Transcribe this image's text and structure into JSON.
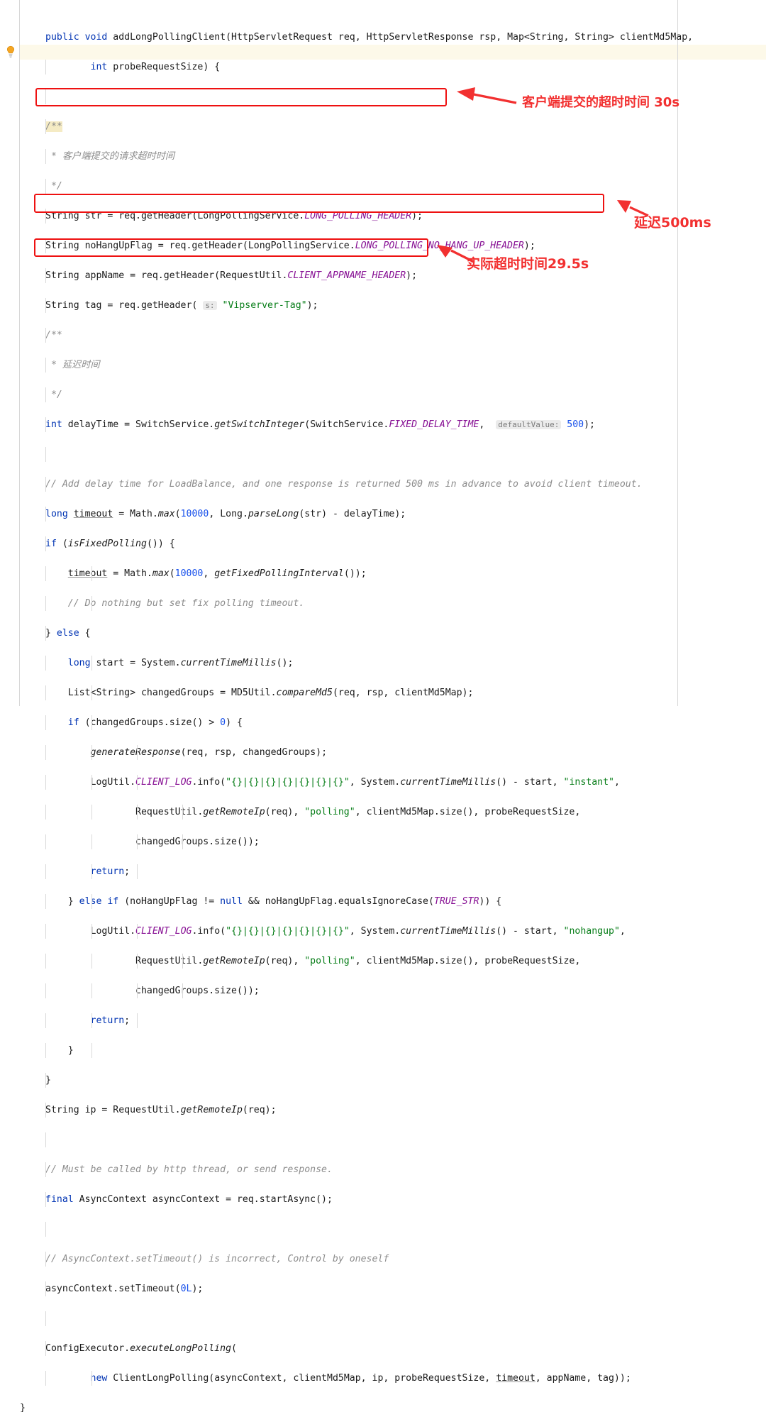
{
  "app": {
    "kind": "code-editor",
    "language": "java"
  },
  "gutter": {
    "icon": "lightbulb-icon"
  },
  "colors": {
    "background": "#ffffff",
    "keyword": "#0033b3",
    "number": "#1750eb",
    "string": "#067d17",
    "comment": "#8c8c8c",
    "static_field": "#871094",
    "annotation_red": "#f23030",
    "box_red": "#ee1111",
    "caret_line": "#fdf9e9",
    "guide": "#d8d8d8"
  },
  "code": {
    "lines": [
      "public void addLongPollingClient(HttpServletRequest req, HttpServletResponse rsp, Map<String, String> clientMd5Map,",
      "        int probeRequestSize) {",
      "",
      "    /**",
      "     * 客户端提交的请求超时时间",
      "     */",
      "    String str = req.getHeader(LongPollingService.LONG_POLLING_HEADER);",
      "    String noHangUpFlag = req.getHeader(LongPollingService.LONG_POLLING_NO_HANG_UP_HEADER);",
      "    String appName = req.getHeader(RequestUtil.CLIENT_APPNAME_HEADER);",
      "    String tag = req.getHeader( s: \"Vipserver-Tag\");",
      "    /**",
      "     * 延迟时间",
      "     */",
      "    int delayTime = SwitchService.getSwitchInteger(SwitchService.FIXED_DELAY_TIME,  defaultValue: 500);",
      "",
      "    // Add delay time for LoadBalance, and one response is returned 500 ms in advance to avoid client timeout.",
      "    long timeout = Math.max(10000, Long.parseLong(str) - delayTime);",
      "    if (isFixedPolling()) {",
      "        timeout = Math.max(10000, getFixedPollingInterval());",
      "        // Do nothing but set fix polling timeout.",
      "    } else {",
      "        long start = System.currentTimeMillis();",
      "        List<String> changedGroups = MD5Util.compareMd5(req, rsp, clientMd5Map);",
      "        if (changedGroups.size() > 0) {",
      "            generateResponse(req, rsp, changedGroups);",
      "            LogUtil.CLIENT_LOG.info(\"{}|{}|{}|{}|{}|{}|{}\", System.currentTimeMillis() - start, \"instant\",",
      "                    RequestUtil.getRemoteIp(req), \"polling\", clientMd5Map.size(), probeRequestSize,",
      "                    changedGroups.size());",
      "            return;",
      "        } else if (noHangUpFlag != null && noHangUpFlag.equalsIgnoreCase(TRUE_STR)) {",
      "            LogUtil.CLIENT_LOG.info(\"{}|{}|{}|{}|{}|{}|{}\", System.currentTimeMillis() - start, \"nohangup\",",
      "                    RequestUtil.getRemoteIp(req), \"polling\", clientMd5Map.size(), probeRequestSize,",
      "                    changedGroups.size());",
      "            return;",
      "        }",
      "    }",
      "    String ip = RequestUtil.getRemoteIp(req);",
      "",
      "    // Must be called by http thread, or send response.",
      "    final AsyncContext asyncContext = req.startAsync();",
      "",
      "    // AsyncContext.setTimeout() is incorrect, Control by oneself",
      "    asyncContext.setTimeout(0L);",
      "",
      "    ConfigExecutor.executeLongPolling(",
      "            new ClientLongPolling(asyncContext, clientMd5Map, ip, probeRequestSize, timeout, appName, tag));",
      "}"
    ]
  },
  "annotations": [
    {
      "id": "client-timeout",
      "label": "客户端提交的超时时间 30s",
      "target_code": "String str = req.getHeader(LongPollingService.LONG_POLLING_HEADER);"
    },
    {
      "id": "fixed-delay",
      "label": "延迟500ms",
      "target_code": "int delayTime = SwitchService.getSwitchInteger(SwitchService.FIXED_DELAY_TIME,  defaultValue: 500);"
    },
    {
      "id": "actual-timeout",
      "label": "实际超时时间29.5s",
      "target_code": "long timeout = Math.max(10000, Long.parseLong(str) - delayTime);"
    }
  ]
}
